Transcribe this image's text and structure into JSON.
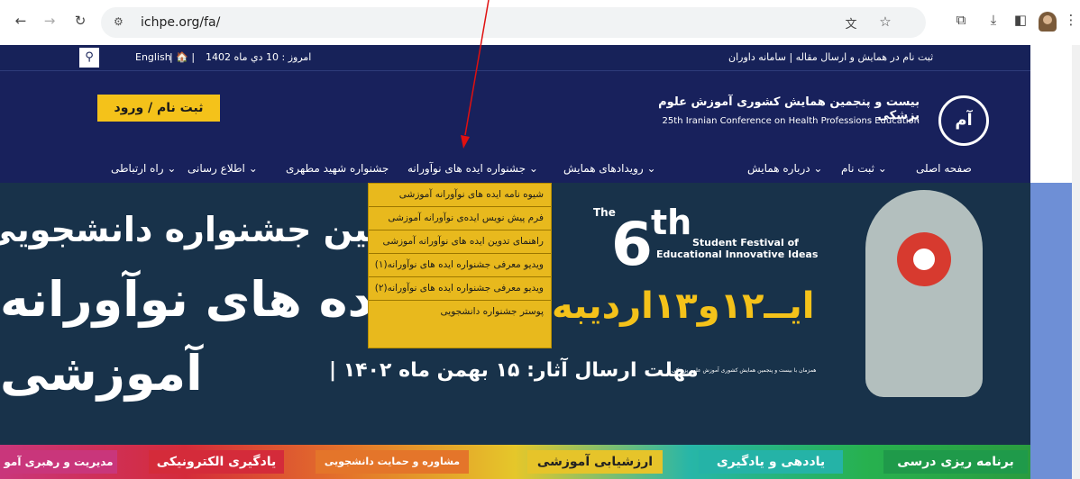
{
  "browser": {
    "url": "ichpe.org/fa/"
  },
  "topbar": {
    "date": "امروز : 10 دي ماه 1402",
    "home_sep": "| 🏠 |",
    "english": "English",
    "links": "ثبت نام در همایش و ارسال مقاله   |   سامانه داوران"
  },
  "header": {
    "register_button": "ثبت نام / ورود",
    "title_fa": "بیست و پنجمین همایش کشوری آموزش علوم پزشکی",
    "title_en": "25th Iranian Conference on Health Professions Education",
    "logo_text": "آم"
  },
  "menu": {
    "items": [
      "صفحه اصلی",
      "ثبت نام ⌄",
      "درباره همایش ⌄",
      "رویدادهای همایش ⌄",
      "جشنواره ایده های نوآورانه ⌄",
      "جشنواره شهید مطهری",
      "اطلاع رسانی ⌄",
      "راه ارتباطی ⌄"
    ]
  },
  "dropdown": {
    "items": [
      "شیوه نامه ایده های نوآورانه آموزشی",
      "فرم پیش نویس ایده‌ی نوآورانه آموزشی",
      "راهنمای تدوین ایده های نوآورانه آموزشی",
      "ویدیو معرفی جشنواره ایده های نوآورانه(۱)",
      "ویدیو معرفی جشنواره ایده های نوآورانه(۲)",
      "پوستر جشنواره دانشجویی"
    ]
  },
  "banner": {
    "line1": "ششمین جشنواره دانشجویی",
    "line2": "ده های نوآورانه",
    "line3": "آموزشی",
    "the": "The",
    "sixth": "6",
    "th": "th",
    "festival_en1": "Student Festival of",
    "festival_en2": "Educational Innovative Ideas",
    "dates": "ایــ۱۲و۱۳اردیبه",
    "deadline": "| مهلت ارسال آثار:   ۱۵ بهمن ماه ۱۴۰۲",
    "small_note": "همزمان با بیست و پنجمین همایش کشوری آموزش علوم پزشکی",
    "categories": [
      "برنامه ریزی درسی",
      "یاددهی و یادگیری",
      "ارزشیابی آموزشی",
      "مشاوره و حمایت دانشجویی",
      "یادگیری الکترونیکی",
      "مدیریت و رهبری آمو"
    ]
  },
  "colors": {
    "navy": "#172259",
    "accent": "#f4c21a",
    "dropdown": "#e8b91d"
  }
}
